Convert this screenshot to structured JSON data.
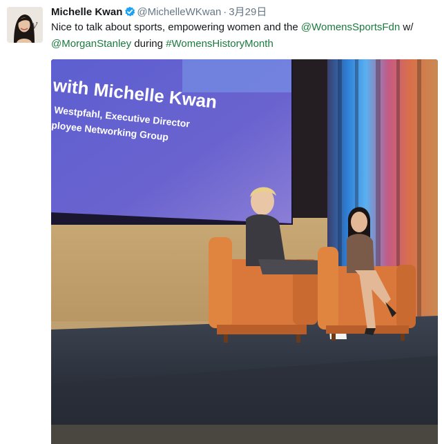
{
  "tweet": {
    "author_name": "Michelle Kwan",
    "handle": "@MichelleWKwan",
    "separator": "·",
    "timestamp": "3月29日",
    "text_segments": [
      {
        "text": "Nice to talk about sports, empowering women and the ",
        "type": "text"
      },
      {
        "text": "@WomensSportsFdn",
        "type": "mention"
      },
      {
        "text": " w/ ",
        "type": "text"
      },
      {
        "text": "@MorganStanley",
        "type": "mention"
      },
      {
        "text": " during ",
        "type": "text"
      },
      {
        "text": "#WomensHistoryMonth",
        "type": "hashtag"
      }
    ],
    "link_color": "#1b7a3e",
    "verified_color": "#1da1f2",
    "icons": {
      "verified": "verified-badge-icon"
    },
    "photo": {
      "slide_line1": "with Michelle Kwan",
      "slide_line2": "Westpfahl, Executive Director",
      "slide_line3": "ployee Networking Group"
    }
  }
}
